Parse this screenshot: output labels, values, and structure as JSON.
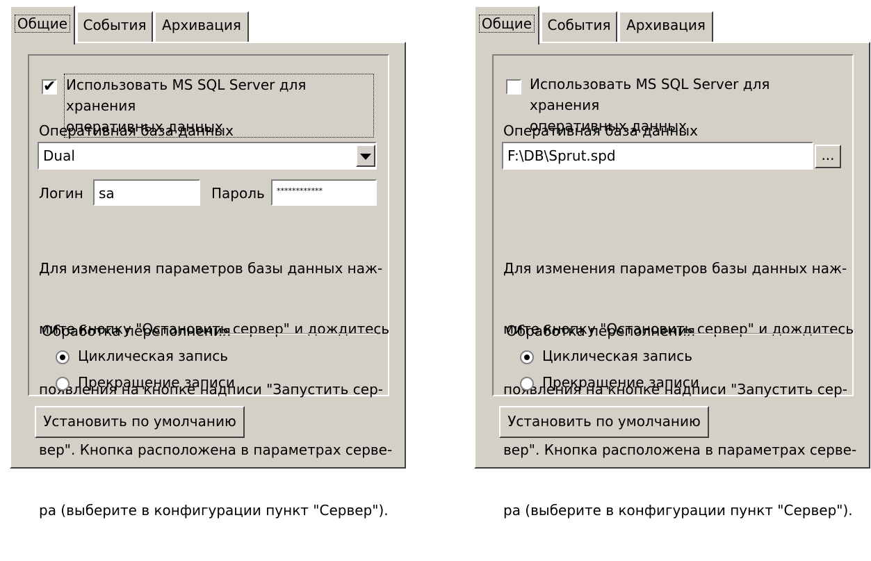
{
  "tabs": [
    "Общие",
    "События",
    "Архивация"
  ],
  "left": {
    "checkbox_checked": true,
    "checkbox_mark": "✔",
    "checkbox_label_line1": "Использовать MS SQL Server для хранения",
    "checkbox_label_line2": "оперативных данных",
    "db_label": "Оперативная база данных",
    "db_value": "Dual",
    "login_label": "Логин",
    "login_value": "sa",
    "password_label": "Пароль",
    "password_value": "************",
    "description": [
      "Для изменения параметров базы данных наж-",
      "мите кнопку \"Остановить сервер\" и дождитесь",
      "появления на кнопке надписи \"Запустить сер-",
      "вер\". Кнопка расположена в параметрах серве-",
      "ра (выберите в конфигурации пункт \"Сервер\")."
    ],
    "overflow_label": "Обработка переполнения",
    "radio_cyclic": "Циклическая запись",
    "radio_stop": "Прекращение записи",
    "selected_radio": "cyclic",
    "default_button": "Установить по умолчанию"
  },
  "right": {
    "checkbox_checked": false,
    "checkbox_label_line1": "Использовать MS SQL Server для хранения",
    "checkbox_label_line2": "оперативных данных",
    "db_label": "Оперативная база данных",
    "db_value": "F:\\DB\\Sprut.spd",
    "browse_button": "...",
    "description": [
      "Для изменения параметров базы данных наж-",
      "мите кнопку \"Остановить сервер\" и дождитесь",
      "появления на кнопке надписи \"Запустить сер-",
      "вер\". Кнопка расположена в параметрах серве-",
      "ра (выберите в конфигурации пункт \"Сервер\")."
    ],
    "overflow_label": "Обработка переполнения",
    "radio_cyclic": "Циклическая запись",
    "radio_stop": "Прекращение записи",
    "selected_radio": "cyclic",
    "default_button": "Установить по умолчанию"
  }
}
